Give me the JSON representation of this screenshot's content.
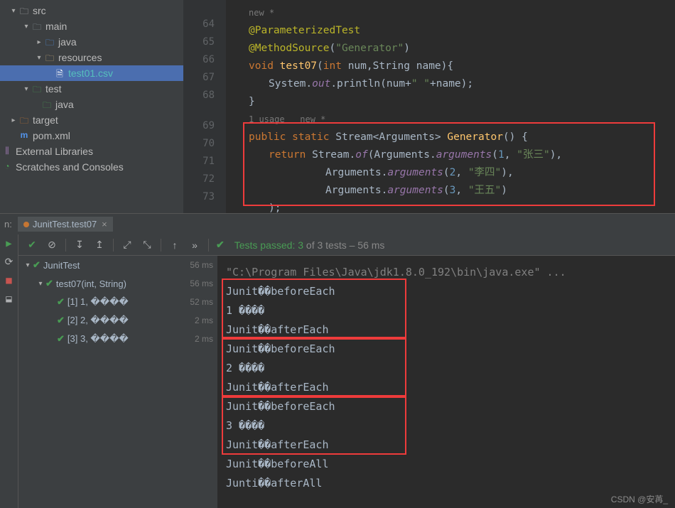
{
  "tree": {
    "src": "src",
    "main": "main",
    "java1": "java",
    "resources": "resources",
    "testfile": "test01.csv",
    "test": "test",
    "java2": "java",
    "target": "target",
    "pom": "pom.xml",
    "extlib": "External Libraries",
    "scratches": "Scratches and Consoles"
  },
  "gutter": [
    "64",
    "65",
    "66",
    "67",
    "68",
    "",
    "69",
    "70",
    "71",
    "72",
    "73"
  ],
  "code": {
    "hint1": "new *",
    "l1": "@ParameterizedTest",
    "l2a": "@MethodSource",
    "l2b": "(",
    "l2c": "\"Generator\"",
    "l2d": ")",
    "l3_kw": "void ",
    "l3_m": "test07",
    "l3_p": "(",
    "l3_kw2": "int ",
    "l3_p2": "num,String name){",
    "l4a": "System.",
    "l4b": "out",
    "l4c": ".println(num+",
    "l4d": "\" \"",
    "l4e": "+name);",
    "l5": "}",
    "hint2": "1 usage   new *",
    "l6_kw": "public static ",
    "l6_t": "Stream<Arguments> ",
    "l6_m": "Generator",
    "l6_e": "() {",
    "l7_kw": "return ",
    "l7_a": "Stream.",
    "l7_m": "of",
    "l7_b": "(Arguments.",
    "l7_m2": "arguments",
    "l7_c": "(",
    "l7_n": "1",
    "l7_d": ", ",
    "l7_s": "\"张三\"",
    "l7_e": "),",
    "l8_a": "Arguments.",
    "l8_m": "arguments",
    "l8_b": "(",
    "l8_n": "2",
    "l8_c": ", ",
    "l8_s": "\"李四\"",
    "l8_d": "),",
    "l9_a": "Arguments.",
    "l9_m": "arguments",
    "l9_b": "(",
    "l9_n": "3",
    "l9_c": ", ",
    "l9_s": "\"王五\"",
    "l9_d": ")",
    "l10": ");"
  },
  "run": {
    "label": "n:",
    "tab": "JunitTest.test07"
  },
  "toolbar": {
    "passed_prefix": "Tests passed: ",
    "passed_count": "3",
    "passed_suffix": " of 3 tests – 56 ms"
  },
  "tests": {
    "root": "JunitTest",
    "root_ms": "56 ms",
    "t1": "test07(int, String)",
    "t1_ms": "56 ms",
    "i1": "[1] 1, ����",
    "i1_ms": "52 ms",
    "i2": "[2] 2, ����",
    "i2_ms": "2 ms",
    "i3": "[3] 3, ����",
    "i3_ms": "2 ms"
  },
  "console": {
    "cmd": "\"C:\\Program Files\\Java\\jdk1.8.0_192\\bin\\java.exe\" ...",
    "b1": "Junit��beforeEach",
    "v1": "1 ����",
    "a1": "Junit��afterEach",
    "b2": "Junit��beforeEach",
    "v2": "2 ����",
    "a2": "Junit��afterEach",
    "b3": "Junit��beforeEach",
    "v3": "3 ����",
    "a3": "Junit��afterEach",
    "ball": "Junit��beforeAll",
    "aall": "Junti��afterAll"
  },
  "watermark": "CSDN @安苒_"
}
